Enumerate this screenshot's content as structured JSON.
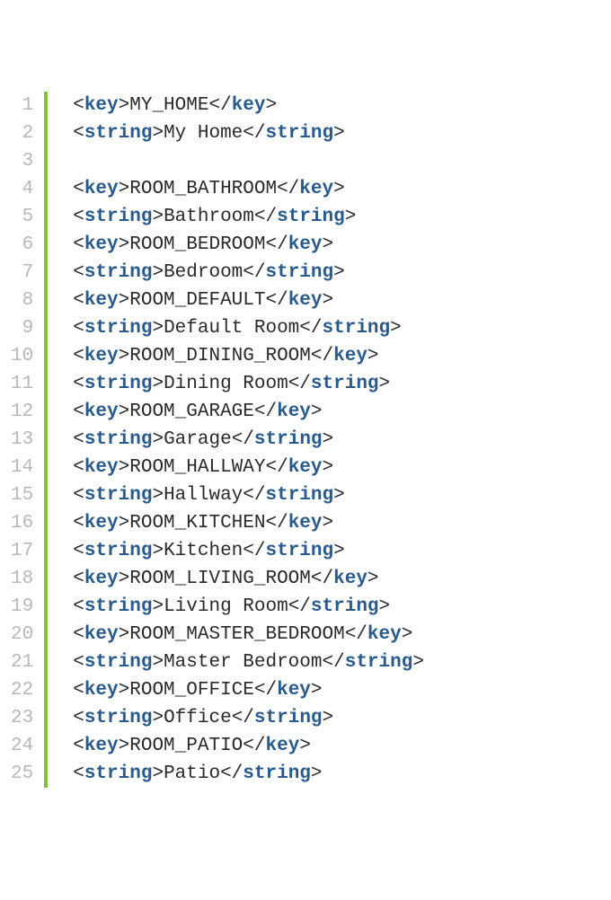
{
  "lines": [
    {
      "num": "1",
      "type": "tag",
      "tag": "key",
      "value": "MY_HOME"
    },
    {
      "num": "2",
      "type": "tag",
      "tag": "string",
      "value": "My Home"
    },
    {
      "num": "3",
      "type": "blank"
    },
    {
      "num": "4",
      "type": "tag",
      "tag": "key",
      "value": "ROOM_BATHROOM"
    },
    {
      "num": "5",
      "type": "tag",
      "tag": "string",
      "value": "Bathroom"
    },
    {
      "num": "6",
      "type": "tag",
      "tag": "key",
      "value": "ROOM_BEDROOM"
    },
    {
      "num": "7",
      "type": "tag",
      "tag": "string",
      "value": "Bedroom"
    },
    {
      "num": "8",
      "type": "tag",
      "tag": "key",
      "value": "ROOM_DEFAULT"
    },
    {
      "num": "9",
      "type": "tag",
      "tag": "string",
      "value": "Default Room"
    },
    {
      "num": "10",
      "type": "tag",
      "tag": "key",
      "value": "ROOM_DINING_ROOM"
    },
    {
      "num": "11",
      "type": "tag",
      "tag": "string",
      "value": "Dining Room"
    },
    {
      "num": "12",
      "type": "tag",
      "tag": "key",
      "value": "ROOM_GARAGE"
    },
    {
      "num": "13",
      "type": "tag",
      "tag": "string",
      "value": "Garage"
    },
    {
      "num": "14",
      "type": "tag",
      "tag": "key",
      "value": "ROOM_HALLWAY"
    },
    {
      "num": "15",
      "type": "tag",
      "tag": "string",
      "value": "Hallway"
    },
    {
      "num": "16",
      "type": "tag",
      "tag": "key",
      "value": "ROOM_KITCHEN"
    },
    {
      "num": "17",
      "type": "tag",
      "tag": "string",
      "value": "Kitchen"
    },
    {
      "num": "18",
      "type": "tag",
      "tag": "key",
      "value": "ROOM_LIVING_ROOM"
    },
    {
      "num": "19",
      "type": "tag",
      "tag": "string",
      "value": "Living Room"
    },
    {
      "num": "20",
      "type": "tag",
      "tag": "key",
      "value": "ROOM_MASTER_BEDROOM"
    },
    {
      "num": "21",
      "type": "tag",
      "tag": "string",
      "value": "Master Bedroom"
    },
    {
      "num": "22",
      "type": "tag",
      "tag": "key",
      "value": "ROOM_OFFICE"
    },
    {
      "num": "23",
      "type": "tag",
      "tag": "string",
      "value": "Office"
    },
    {
      "num": "24",
      "type": "tag",
      "tag": "key",
      "value": "ROOM_PATIO"
    },
    {
      "num": "25",
      "type": "tag",
      "tag": "string",
      "value": "Patio"
    }
  ]
}
